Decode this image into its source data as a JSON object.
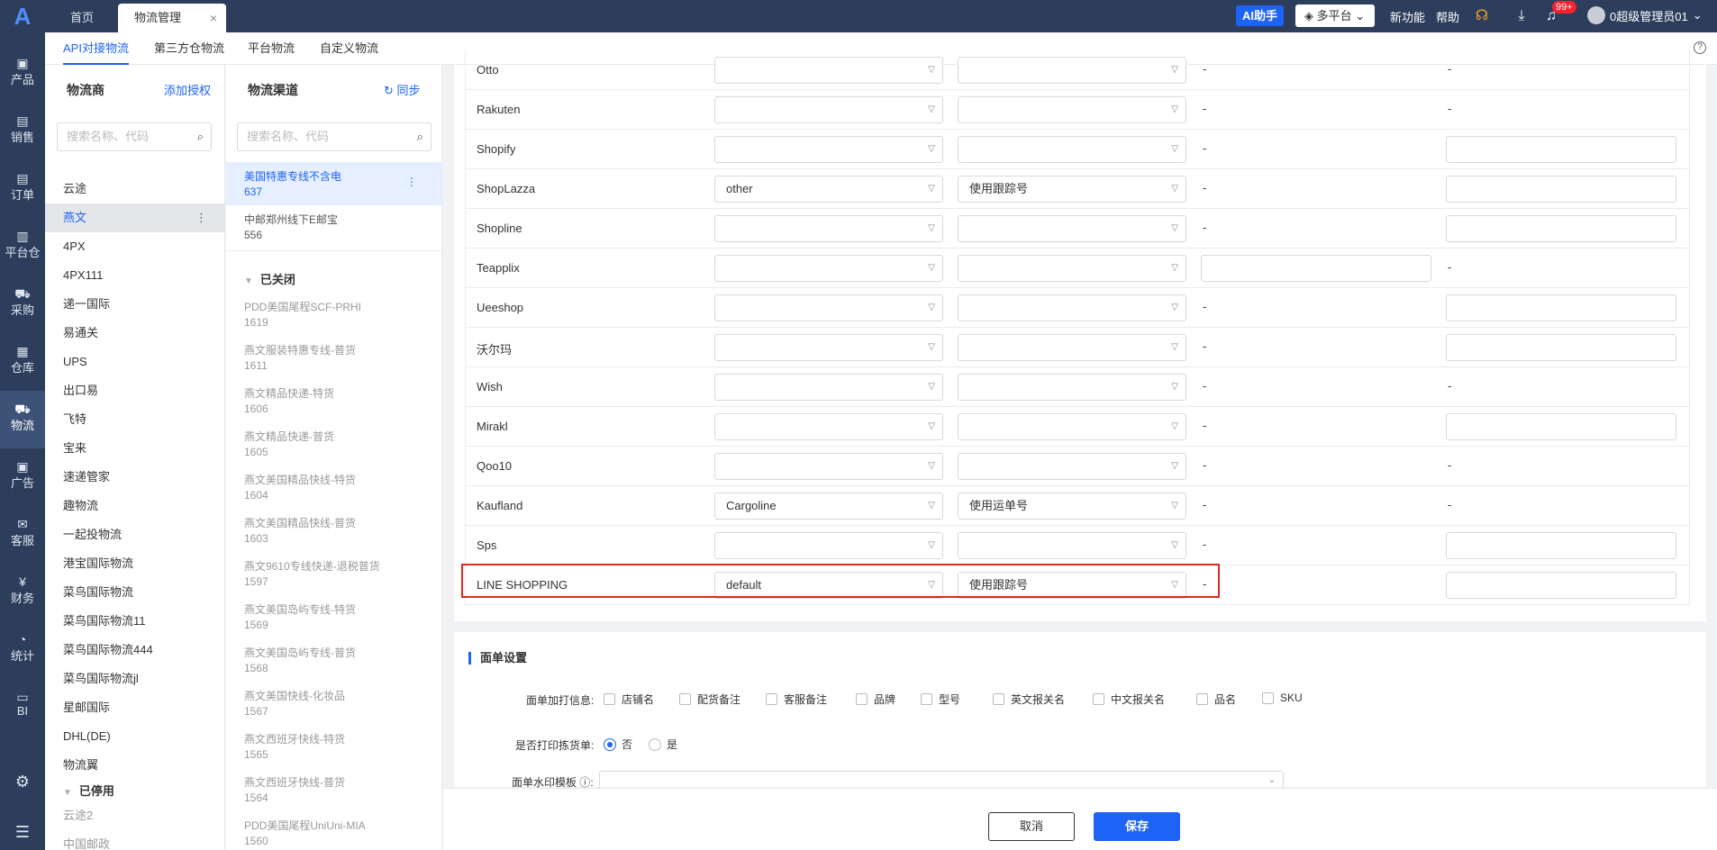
{
  "topbar": {
    "logo": "A",
    "tabs": [
      {
        "label": "首页"
      },
      {
        "label": "物流管理"
      }
    ],
    "close_glyph": "×",
    "ai_button": "AI助手",
    "platform_select": "多平台",
    "new_features": "新功能",
    "help": "帮助",
    "notification_badge": "99+",
    "username": "0超级管理员01"
  },
  "sidenav": {
    "items": [
      {
        "label": "产品",
        "icon": "box-icon"
      },
      {
        "label": "销售",
        "icon": "sell-icon"
      },
      {
        "label": "订单",
        "icon": "order-icon"
      },
      {
        "label": "平台仓",
        "icon": "platform-warehouse-icon"
      },
      {
        "label": "采购",
        "icon": "cart-icon"
      },
      {
        "label": "仓库",
        "icon": "warehouse-icon"
      },
      {
        "label": "物流",
        "icon": "truck-icon"
      },
      {
        "label": "广告",
        "icon": "ad-icon"
      },
      {
        "label": "客服",
        "icon": "mail-icon"
      },
      {
        "label": "财务",
        "icon": "yen-icon"
      },
      {
        "label": "统计",
        "icon": "pie-icon"
      },
      {
        "label": "BI",
        "icon": "bi-icon"
      }
    ],
    "active": "物流"
  },
  "subtabs": [
    "API对接物流",
    "第三方仓物流",
    "平台物流",
    "自定义物流"
  ],
  "carriers": {
    "title": "物流商",
    "add_link": "添加授权",
    "search_placeholder": "搜索名称、代码",
    "items": [
      "云途",
      "燕文",
      "4PX",
      "4PX111",
      "递一国际",
      "易通关",
      "UPS",
      "出口易",
      "飞特",
      "宝来",
      "速递管家",
      "趣物流",
      "一起投物流",
      "港宝国际物流",
      "菜鸟国际物流",
      "菜鸟国际物流11",
      "菜鸟国际物流444",
      "菜鸟国际物流jl",
      "星邮国际",
      "DHL(DE)",
      "物流翼"
    ],
    "active": "燕文",
    "disabled_group": "已停用",
    "disabled_items": [
      "云途2",
      "中国邮政"
    ]
  },
  "channels": {
    "title": "物流渠道",
    "sync_link": "同步",
    "search_placeholder": "搜索名称、代码",
    "active_items": [
      {
        "name": "美国特惠专线不含电",
        "code": "637"
      },
      {
        "name": "中邮郑州线下E邮宝",
        "code": "556"
      }
    ],
    "closed_group": "已关闭",
    "closed_items": [
      {
        "name": "PDD美国尾程SCF-PRHI",
        "code": "1619"
      },
      {
        "name": "燕文服装特惠专线-普货",
        "code": "1611"
      },
      {
        "name": "燕文精品快递-特货",
        "code": "1606"
      },
      {
        "name": "燕文精品快递-普货",
        "code": "1605"
      },
      {
        "name": "燕文美国精品快线-特货",
        "code": "1604"
      },
      {
        "name": "燕文美国精品快线-普货",
        "code": "1603"
      },
      {
        "name": "燕文9610专线快递-退税普货",
        "code": "1597"
      },
      {
        "name": "燕文美国岛屿专线-特货",
        "code": "1569"
      },
      {
        "name": "燕文美国岛屿专线-普货",
        "code": "1568"
      },
      {
        "name": "燕文美国快线-化妆品",
        "code": "1567"
      },
      {
        "name": "燕文西班牙快线-特货",
        "code": "1565"
      },
      {
        "name": "燕文西班牙快线-普货",
        "code": "1564"
      },
      {
        "name": "PDD美国尾程UniUni-MIA",
        "code": "1560"
      }
    ]
  },
  "platform_rows": [
    {
      "platform": "Otto",
      "carrier": "",
      "tracking": "",
      "col3": "-",
      "col4": "-"
    },
    {
      "platform": "Rakuten",
      "carrier": "",
      "tracking": "",
      "col3": "-",
      "col4": "-"
    },
    {
      "platform": "Shopify",
      "carrier": "",
      "tracking": "",
      "col3": "-",
      "col4": ""
    },
    {
      "platform": "ShopLazza",
      "carrier": "other",
      "tracking": "使用跟踪号",
      "col3": "-",
      "col4": ""
    },
    {
      "platform": "Shopline",
      "carrier": "",
      "tracking": "",
      "col3": "-",
      "col4": ""
    },
    {
      "platform": "Teapplix",
      "carrier": "",
      "tracking": "",
      "col3": "",
      "col4": "-"
    },
    {
      "platform": "Ueeshop",
      "carrier": "",
      "tracking": "",
      "col3": "-",
      "col4": ""
    },
    {
      "platform": "沃尔玛",
      "carrier": "",
      "tracking": "",
      "col3": "-",
      "col4": ""
    },
    {
      "platform": "Wish",
      "carrier": "",
      "tracking": "",
      "col3": "-",
      "col4": "-"
    },
    {
      "platform": "Mirakl",
      "carrier": "",
      "tracking": "",
      "col3": "-",
      "col4": ""
    },
    {
      "platform": "Qoo10",
      "carrier": "",
      "tracking": "",
      "col3": "-",
      "col4": "-"
    },
    {
      "platform": "Kaufland",
      "carrier": "Cargoline",
      "tracking": "使用运单号",
      "col3": "-",
      "col4": "-"
    },
    {
      "platform": "Sps",
      "carrier": "",
      "tracking": "",
      "col3": "-",
      "col4": ""
    },
    {
      "platform": "LINE SHOPPING",
      "carrier": "default",
      "tracking": "使用跟踪号",
      "col3": "-",
      "col4": ""
    }
  ],
  "label_settings": {
    "title": "面单设置",
    "extra_info_label": "面单加打信息:",
    "extra_info_options": [
      "店铺名",
      "配货备注",
      "客服备注",
      "品牌",
      "型号",
      "英文报关名",
      "中文报关名",
      "品名",
      "SKU"
    ],
    "print_picklist_label": "是否打印拣货单:",
    "print_picklist_options": [
      "否",
      "是"
    ],
    "print_picklist_value": "否",
    "watermark_label": "面单水印模板"
  },
  "footer": {
    "cancel": "取消",
    "save": "保存"
  }
}
